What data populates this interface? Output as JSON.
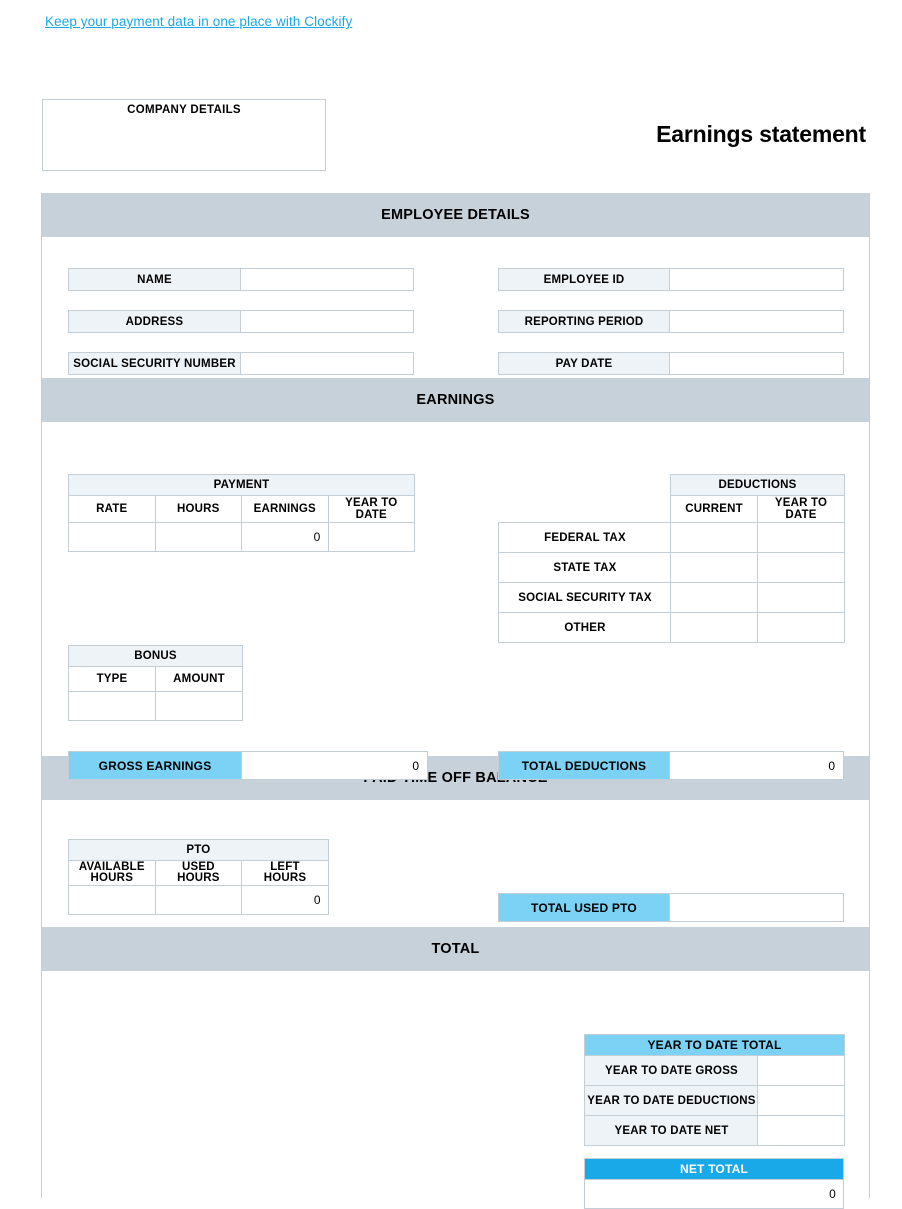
{
  "promo": {
    "link_text": "Keep your payment data in one place with Clockify"
  },
  "header": {
    "company_box_title": "COMPANY DETAILS",
    "doc_title": "Earnings statement"
  },
  "sections": {
    "employee_details": {
      "band": "EMPLOYEE DETAILS"
    },
    "earnings": {
      "band": "EARNINGS"
    },
    "pto": {
      "band": "PAID TIME OFF BALANCE"
    },
    "total": {
      "band": "TOTAL"
    }
  },
  "employee_details": {
    "left": [
      {
        "label": "NAME",
        "value": ""
      },
      {
        "label": "ADDRESS",
        "value": ""
      },
      {
        "label": "SOCIAL SECURITY NUMBER",
        "value": ""
      }
    ],
    "right": [
      {
        "label": "EMPLOYEE ID",
        "value": ""
      },
      {
        "label": "REPORTING PERIOD",
        "value": ""
      },
      {
        "label": "PAY DATE",
        "value": ""
      }
    ]
  },
  "payment_table": {
    "title": "PAYMENT",
    "columns": [
      "RATE",
      "HOURS",
      "EARNINGS",
      "YEAR TO DATE"
    ],
    "rows": [
      {
        "rate": "",
        "hours": "",
        "earnings": "0",
        "year_to_date": ""
      }
    ]
  },
  "bonus_table": {
    "title": "BONUS",
    "columns": [
      "TYPE",
      "AMOUNT"
    ],
    "rows": [
      {
        "type": "",
        "amount": ""
      }
    ]
  },
  "gross_earnings": {
    "label": "GROSS EARNINGS",
    "value": "0"
  },
  "deductions_table": {
    "title": "DEDUCTIONS",
    "columns": [
      "CURRENT",
      "YEAR TO DATE"
    ],
    "rows": [
      {
        "label": "FEDERAL TAX",
        "current": "",
        "year_to_date": ""
      },
      {
        "label": "STATE TAX",
        "current": "",
        "year_to_date": ""
      },
      {
        "label": "SOCIAL SECURITY TAX",
        "current": "",
        "year_to_date": ""
      },
      {
        "label": "OTHER",
        "current": "",
        "year_to_date": ""
      }
    ]
  },
  "total_deductions": {
    "label": "TOTAL DEDUCTIONS",
    "value": "0"
  },
  "pto_table": {
    "title": "PTO",
    "columns": [
      "AVAILABLE\nHOURS",
      "USED\nHOURS",
      "LEFT\nHOURS"
    ],
    "columns_line1": [
      "AVAILABLE",
      "USED",
      "LEFT"
    ],
    "columns_line2": [
      "HOURS",
      "HOURS",
      "HOURS"
    ],
    "rows": [
      {
        "available": "",
        "used": "",
        "left": "0"
      }
    ]
  },
  "total_used_pto": {
    "label": "TOTAL USED PTO",
    "value": ""
  },
  "year_to_date_total": {
    "title": "YEAR TO DATE TOTAL",
    "rows": [
      {
        "label": "YEAR TO DATE GROSS",
        "value": ""
      },
      {
        "label": "YEAR TO DATE DEDUCTIONS",
        "value": ""
      },
      {
        "label": "YEAR TO DATE NET",
        "value": ""
      }
    ]
  },
  "net_total": {
    "title": "NET TOTAL",
    "value": "0"
  },
  "colors": {
    "band_gray": "#c6d1d9",
    "label_fill": "#eef3f7",
    "accent_light_blue": "#7bd2f5",
    "accent_blue": "#19a9e8",
    "border": "#c3ced6"
  }
}
